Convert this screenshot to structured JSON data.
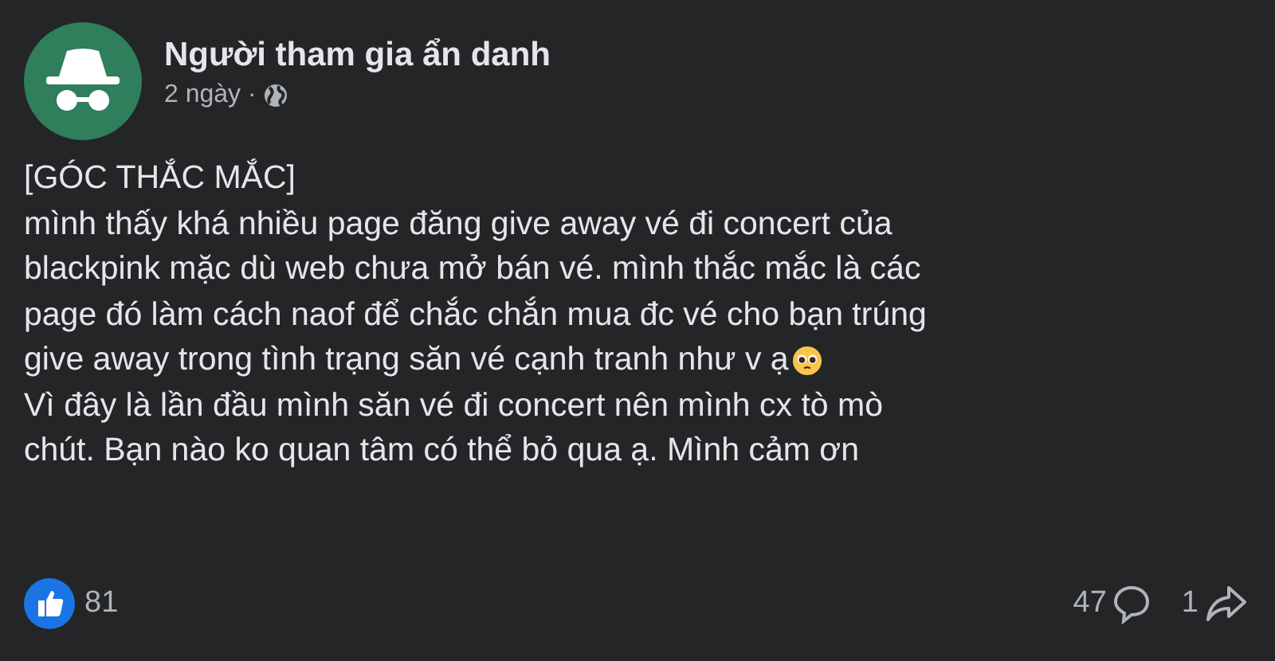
{
  "author": {
    "name": "Người tham gia ẩn danh",
    "time": "2 ngày ·"
  },
  "body": [
    "[GÓC THẮC MẮC]",
    "mình thấy khá nhiều page đăng give away vé đi concert của",
    "blackpink mặc dù web chưa mở bán vé. mình thắc mắc là các",
    "page đó làm cách naof để chắc chắn mua đc vé cho bạn trúng",
    "give away trong tình trạng săn vé cạnh tranh như v ạ",
    "Vì đây là lần đầu mình săn vé đi concert nên mình cx tò mò",
    "chút. Bạn nào ko quan tâm có thể bỏ qua ạ. Mình cảm ơn"
  ],
  "footer": {
    "likes": "81",
    "comments": "47",
    "shares": "1"
  }
}
